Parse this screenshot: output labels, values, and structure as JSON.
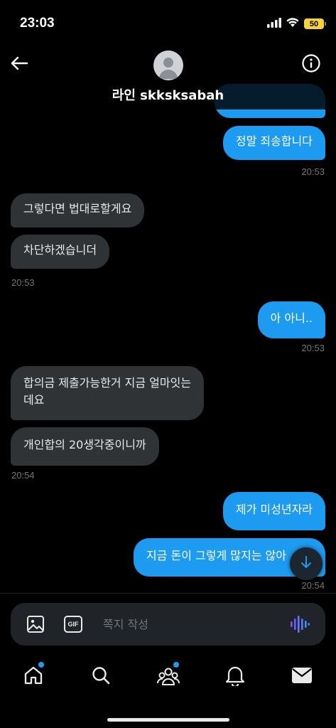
{
  "status": {
    "time": "23:03",
    "battery": "50"
  },
  "header": {
    "title": "라인 skksksabah"
  },
  "messages": [
    {
      "dir": "out",
      "text": "정말 죄송합니다"
    },
    {
      "dir": "in",
      "text": "그렇다면 법대로할게요"
    },
    {
      "dir": "in",
      "text": "차단하겠습니더"
    },
    {
      "dir": "out",
      "text": "아 아니.."
    },
    {
      "dir": "in",
      "text_line1": "합의금 제출가능한거 지금 얼마잇는",
      "text_line2": "데요"
    },
    {
      "dir": "in",
      "text": "개인합의 20생각중이니까"
    },
    {
      "dir": "out",
      "text": "제가 미성년자라"
    },
    {
      "dir": "out",
      "text": "지금 돈이 그렇게 많지는 않아"
    }
  ],
  "timestamps": [
    "20:53",
    "20:53",
    "20:53",
    "20:54",
    "20:54"
  ],
  "composer": {
    "placeholder": "쪽지 작성",
    "gif_label": "GIF"
  },
  "tabs": [
    "home",
    "search",
    "communities",
    "notifications",
    "messages"
  ],
  "colors": {
    "accent": "#1d9bf0",
    "incoming_bubble": "#2f3336",
    "background": "#000000"
  }
}
